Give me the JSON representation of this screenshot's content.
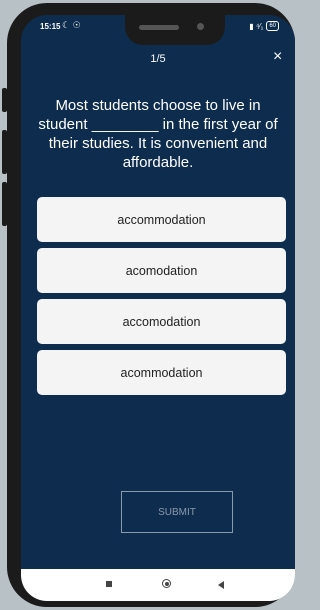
{
  "status": {
    "time": "15:15",
    "notification_icons": "☾ ☉",
    "signal": "▮ ⁴⁄₁",
    "battery": "60"
  },
  "quiz": {
    "progress": "1/5",
    "close_label": "×",
    "question": "Most students choose to live in student ________ in the first year of their studies. It is convenient and affordable.",
    "options": [
      "accommodation",
      "acomodation",
      "accomodation",
      "acommodation"
    ],
    "submit_label": "SUBMIT"
  },
  "colors": {
    "screen_bg": "#0e2c4d",
    "option_bg": "#f4f4f4",
    "submit_border": "#8a9aad"
  },
  "icons": {
    "close": "close-icon",
    "nav_recent": "square-icon",
    "nav_home": "circle-icon",
    "nav_back": "triangle-back-icon"
  }
}
